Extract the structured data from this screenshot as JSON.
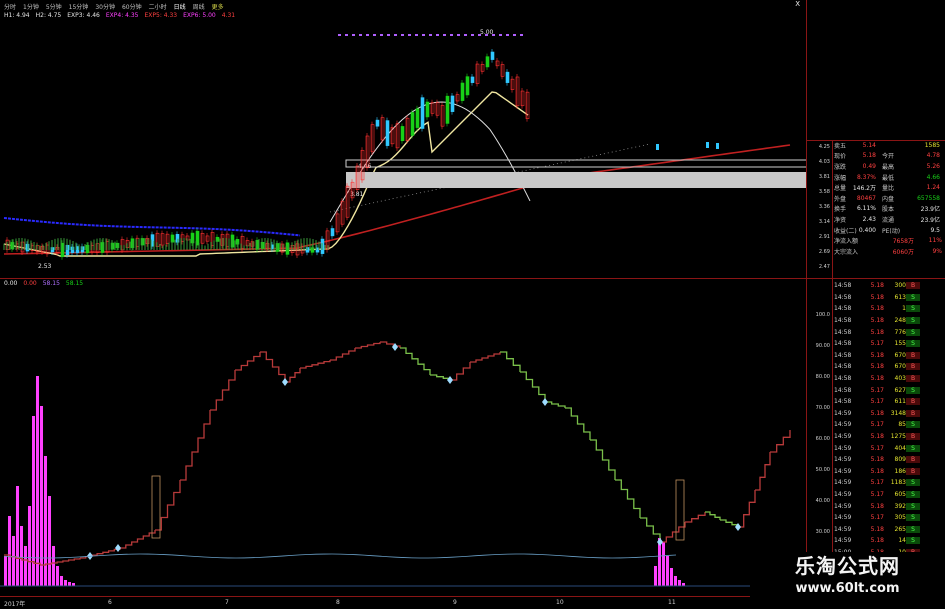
{
  "toolbar": {
    "items": [
      {
        "label": "分时"
      },
      {
        "label": "1分钟"
      },
      {
        "label": "5分钟"
      },
      {
        "label": "15分钟"
      },
      {
        "label": "30分钟"
      },
      {
        "label": "60分钟"
      },
      {
        "label": "二小时"
      },
      {
        "label": "日线"
      },
      {
        "label": "周线"
      },
      {
        "label": "更多"
      }
    ],
    "close_glyph": "X"
  },
  "price_header": {
    "values": [
      "H1: 4.94",
      "H2: 4.75",
      "EXP3: 4.46",
      "EXP4: 4.35",
      "EXP5: 4.33",
      "EXP6: 5.00",
      "4.31"
    ]
  },
  "indicator_header": {
    "values": [
      "0.00",
      "0.00",
      "58.15",
      "58.15"
    ],
    "side_label": "CT"
  },
  "price_axis": {
    "ticks": [
      "4.25",
      "4.03",
      "3.81",
      "3.58",
      "3.36",
      "3.14",
      "2.91",
      "2.69",
      "2.47"
    ]
  },
  "ind_axis": {
    "ticks": [
      "100.0",
      "90.00",
      "80.00",
      "70.00",
      "60.00",
      "50.00",
      "40.00",
      "30.00",
      "20.00"
    ]
  },
  "quote": {
    "sell5": {
      "label": "卖五",
      "price": "5.14",
      "vol": "1585"
    },
    "rows": [
      {
        "l1": "现价",
        "v1": "5.18",
        "l2": "今开",
        "v2": "4.78",
        "c1": "red",
        "c2": "red"
      },
      {
        "l1": "涨跌",
        "v1": "0.49",
        "l2": "最高",
        "v2": "5.26",
        "c1": "red",
        "c2": "red"
      },
      {
        "l1": "涨幅",
        "v1": "8.37%",
        "l2": "最低",
        "v2": "4.66",
        "c1": "red",
        "c2": "green"
      },
      {
        "l1": "总量",
        "v1": "146.2万",
        "l2": "量比",
        "v2": "1.24",
        "c1": "white",
        "c2": "red"
      },
      {
        "l1": "外盘",
        "v1": "80467",
        "l2": "内盘",
        "v2": "657558",
        "c1": "red",
        "c2": "green"
      },
      {
        "l1": "换手",
        "v1": "6.11%",
        "l2": "股本",
        "v2": "23.9亿",
        "c1": "white",
        "c2": "white"
      },
      {
        "l1": "净资",
        "v1": "2.43",
        "l2": "流通",
        "v2": "23.9亿",
        "c1": "white",
        "c2": "white"
      },
      {
        "l1": "收益(二)",
        "v1": "0.400",
        "l2": "PE(动)",
        "v2": "9.5",
        "c1": "white",
        "c2": "white"
      }
    ],
    "flows": [
      {
        "label": "净流入额",
        "val": "7658万",
        "pct": "11%"
      },
      {
        "label": "大宗流入",
        "val": "6060万",
        "pct": "9%"
      }
    ]
  },
  "ticks": [
    {
      "time": "14:58",
      "price": "5.18",
      "vol": "300",
      "side": "B"
    },
    {
      "time": "14:58",
      "price": "5.18",
      "vol": "613",
      "side": "S"
    },
    {
      "time": "14:58",
      "price": "5.18",
      "vol": "1",
      "side": "S"
    },
    {
      "time": "14:58",
      "price": "5.18",
      "vol": "248",
      "side": "S"
    },
    {
      "time": "14:58",
      "price": "5.18",
      "vol": "776",
      "side": "S"
    },
    {
      "time": "14:58",
      "price": "5.17",
      "vol": "155",
      "side": "S"
    },
    {
      "time": "14:58",
      "price": "5.18",
      "vol": "670",
      "side": "B"
    },
    {
      "time": "14:58",
      "price": "5.18",
      "vol": "670",
      "side": "B"
    },
    {
      "time": "14:58",
      "price": "5.18",
      "vol": "403",
      "side": "B"
    },
    {
      "time": "14:58",
      "price": "5.17",
      "vol": "627",
      "side": "S"
    },
    {
      "time": "14:58",
      "price": "5.17",
      "vol": "611",
      "side": "B"
    },
    {
      "time": "14:59",
      "price": "5.18",
      "vol": "3148",
      "side": "B"
    },
    {
      "time": "14:59",
      "price": "5.17",
      "vol": "85",
      "side": "S"
    },
    {
      "time": "14:59",
      "price": "5.18",
      "vol": "1275",
      "side": "B"
    },
    {
      "time": "14:59",
      "price": "5.17",
      "vol": "404",
      "side": "S"
    },
    {
      "time": "14:59",
      "price": "5.18",
      "vol": "809",
      "side": "B"
    },
    {
      "time": "14:59",
      "price": "5.18",
      "vol": "186",
      "side": "B"
    },
    {
      "time": "14:59",
      "price": "5.17",
      "vol": "1183",
      "side": "S"
    },
    {
      "time": "14:59",
      "price": "5.17",
      "vol": "605",
      "side": "S"
    },
    {
      "time": "14:59",
      "price": "5.18",
      "vol": "392",
      "side": "S"
    },
    {
      "time": "14:59",
      "price": "5.17",
      "vol": "305",
      "side": "S"
    },
    {
      "time": "14:59",
      "price": "5.18",
      "vol": "265",
      "side": "S"
    },
    {
      "time": "14:59",
      "price": "5.18",
      "vol": "14",
      "side": "S"
    },
    {
      "time": "15:00",
      "price": "5.18",
      "vol": "10",
      "side": "B"
    }
  ],
  "xaxis": [
    {
      "label": "2017年"
    },
    {
      "label": "6"
    },
    {
      "label": "7"
    },
    {
      "label": "8"
    },
    {
      "label": "9"
    },
    {
      "label": "10"
    },
    {
      "label": "11"
    }
  ],
  "annotations": {
    "price_box": "4.46",
    "price_box2": "3.81",
    "peak_label": "5.00",
    "low_label": "2.53"
  },
  "watermark": {
    "title": "乐淘公式网",
    "url": "www.60lt.com"
  },
  "colors": {
    "up": "#ff3030",
    "down": "#18d018",
    "ma_yellow": "#f0e6a0",
    "ma_red": "#c02020",
    "ma_blue": "#2a2aff",
    "vol_magenta": "#ff40ff",
    "bg": "#000000"
  }
}
